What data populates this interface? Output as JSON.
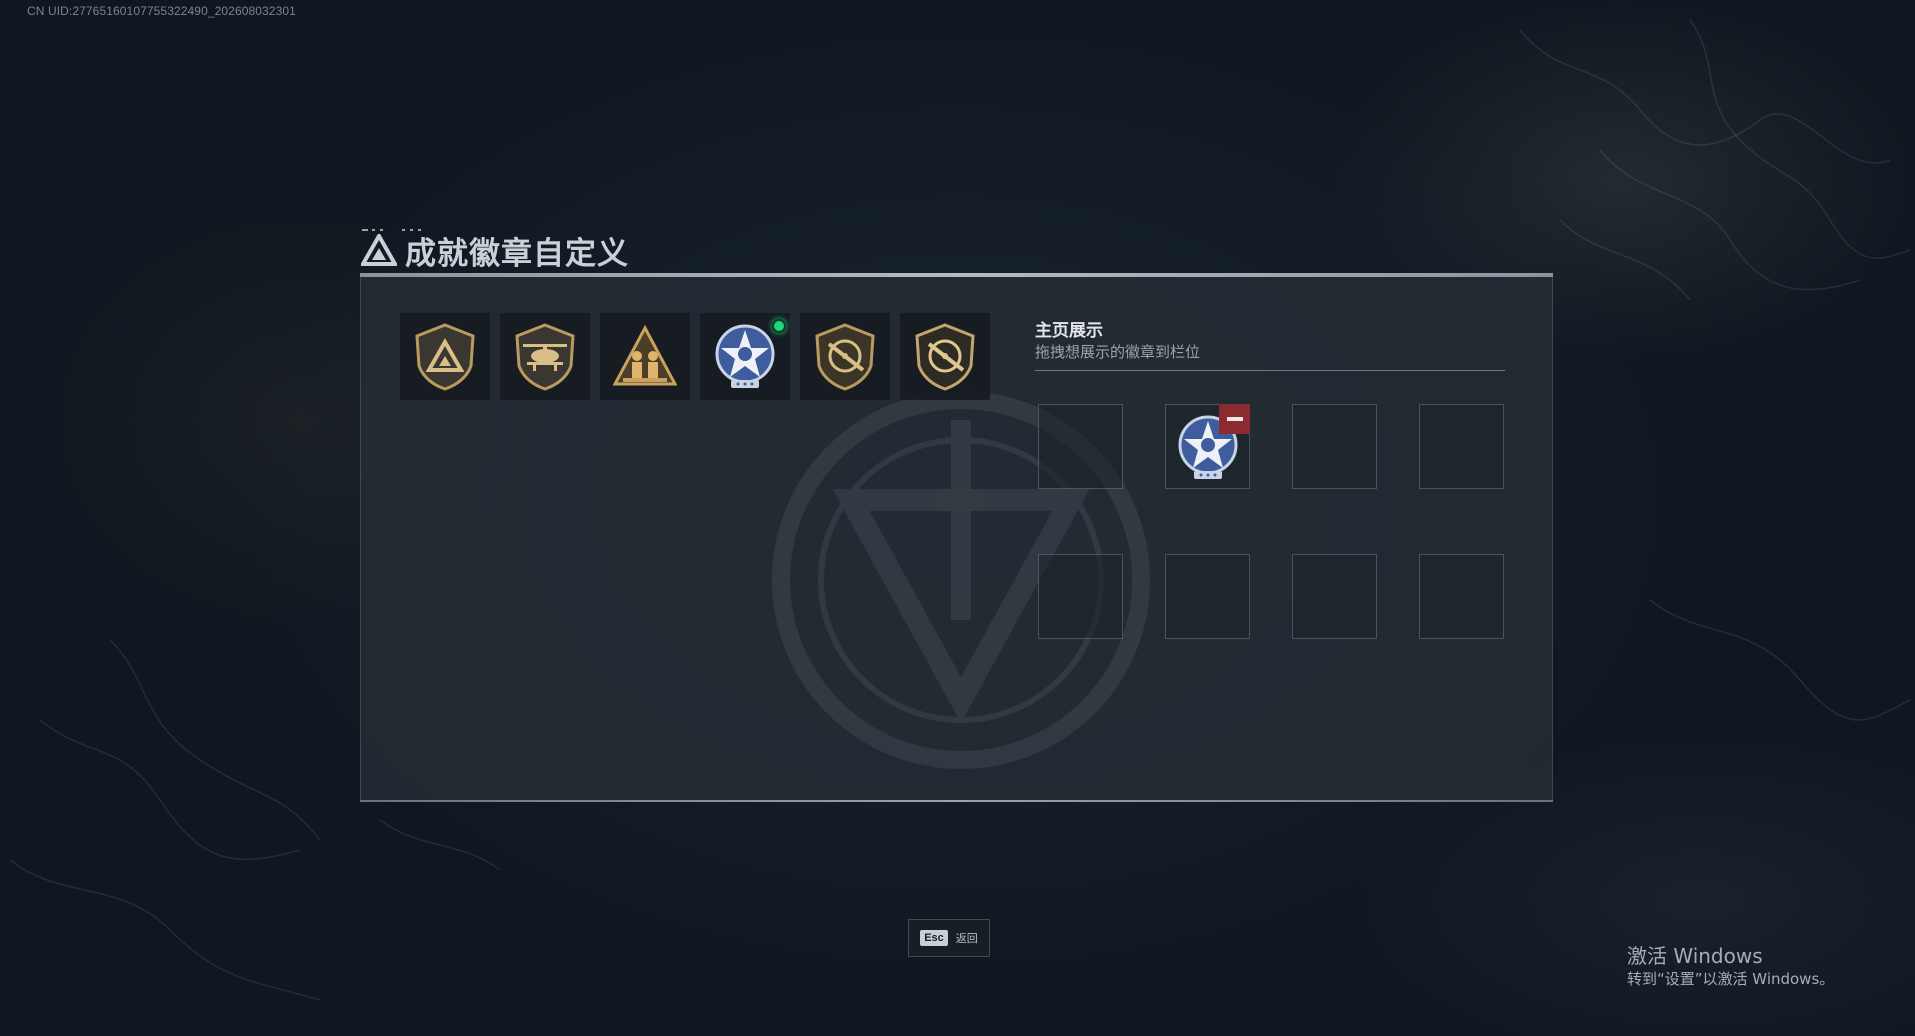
{
  "header": {
    "uid_text": "CN UID:27765160107755322490_202608032301"
  },
  "dialog": {
    "title": "成就徽章自定义",
    "title_icon": "triangle-emblem-icon"
  },
  "badges": [
    {
      "icon": "shield-triangle-badge-icon",
      "new": false
    },
    {
      "icon": "shield-helicopter-badge-icon",
      "new": false
    },
    {
      "icon": "triangle-soldiers-badge-icon",
      "new": false
    },
    {
      "icon": "star-medal-badge-icon",
      "new": true
    },
    {
      "icon": "shield-rifle-badge-icon",
      "new": false
    },
    {
      "icon": "shield-rifle-badge-dark-icon",
      "new": false
    }
  ],
  "showcase": {
    "title": "主页展示",
    "subtitle": "拖拽想展示的徽章到栏位",
    "slots": [
      {
        "filled": false
      },
      {
        "filled": true,
        "badge_icon": "star-medal-badge-icon"
      },
      {
        "filled": false
      },
      {
        "filled": false
      },
      {
        "filled": false
      },
      {
        "filled": false
      },
      {
        "filled": false
      },
      {
        "filled": false
      }
    ]
  },
  "footer": {
    "esc_key": "Esc",
    "esc_label": "返回"
  },
  "watermark": {
    "title": "激活 Windows",
    "subtitle": "转到“设置”以激活 Windows。"
  },
  "colors": {
    "accent_green": "#1fd67a",
    "remove_red": "#8b2b30",
    "badge_gold": "#b99a5f"
  }
}
